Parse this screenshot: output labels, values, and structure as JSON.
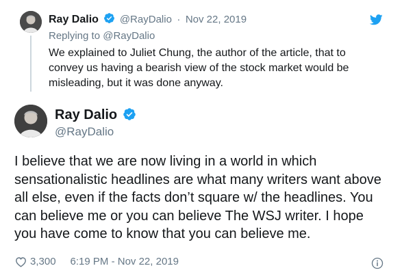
{
  "parent_tweet": {
    "author_name": "Ray Dalio",
    "author_handle": "@RayDalio",
    "separator": "·",
    "date": "Nov 22, 2019",
    "replying_to_prefix": "Replying to",
    "replying_to_handle": "@RayDalio",
    "text_lines": [
      "We explained to Juliet Chung, the author of the article, that to",
      "convey us having a bearish view of the stock market would be",
      "misleading, but it was done anyway."
    ]
  },
  "main_tweet": {
    "author_name": "Ray Dalio",
    "author_handle": "@RayDalio",
    "text_lines": [
      "I believe that we are now living in a world in which",
      "sensationalistic headlines are what many writers want above",
      "all else, even if the facts don’t square w/ the headlines. You",
      "can believe me or you can believe The WSJ writer. I hope",
      "you have come to know that you can believe me."
    ],
    "like_count": "3,300",
    "timestamp": "6:19 PM - Nov 22, 2019"
  },
  "icons": {
    "verified": "verified-badge-icon",
    "twitter": "twitter-bird-icon",
    "like": "heart-icon",
    "info": "info-icon"
  },
  "colors": {
    "twitter_blue": "#1da1f2",
    "text": "#14171a",
    "muted": "#657786",
    "thread_line": "#ccd6dd"
  }
}
